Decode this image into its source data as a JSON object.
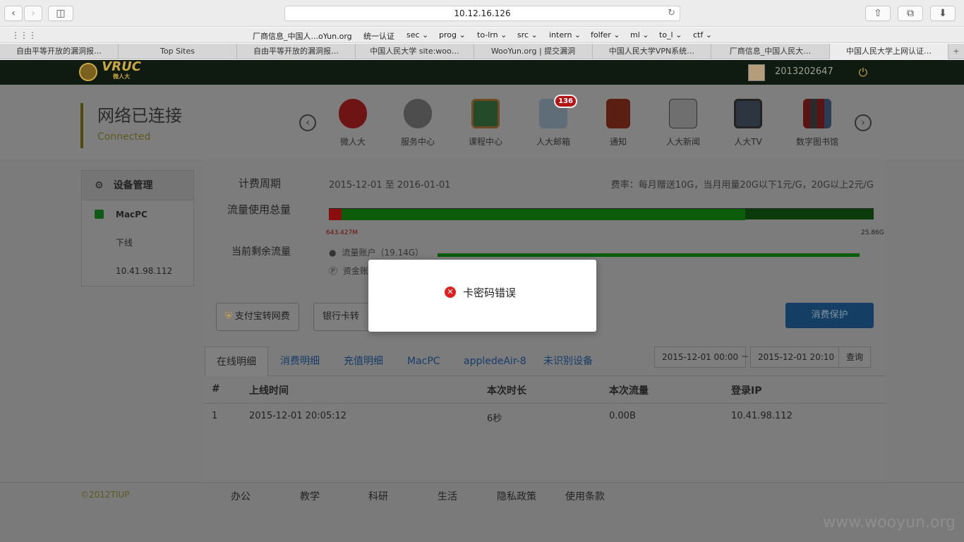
{
  "browser": {
    "url": "10.12.16.126",
    "bookmarks": [
      "厂商信息_中国人...oYun.org",
      "统一认证",
      "sec",
      "prog",
      "to-lrn",
      "src",
      "intern",
      "folfer",
      "ml",
      "to_l",
      "ctf"
    ],
    "tabs": [
      "自由平等开放的漏洞报…",
      "Top Sites",
      "自由平等开放的漏洞报…",
      "中国人民大学 site:woo…",
      "WooYun.org | 提交漏洞",
      "中国人民大学VPN系统…",
      "厂商信息_中国人民大…",
      "中国人民大学上网认证…"
    ]
  },
  "site": {
    "logo_text": "VRUC",
    "logo_sub": "微人大",
    "user_id": "2013202647"
  },
  "status": {
    "title": "网络已连接",
    "subtitle": "Connected"
  },
  "services": [
    {
      "label": "微人大",
      "icon": "weirenda-icon"
    },
    {
      "label": "服务中心",
      "icon": "service-center-icon"
    },
    {
      "label": "课程中心",
      "icon": "course-center-icon"
    },
    {
      "label": "人大邮箱",
      "icon": "mail-icon",
      "badge": "136"
    },
    {
      "label": "通知",
      "icon": "megaphone-icon"
    },
    {
      "label": "人大新闻",
      "icon": "news-icon"
    },
    {
      "label": "人大TV",
      "icon": "tv-icon"
    },
    {
      "label": "数字图书馆",
      "icon": "library-icon"
    }
  ],
  "sidebar": {
    "header": "设备管理",
    "device": "MacPC",
    "action": "下线",
    "ip": "10.41.98.112"
  },
  "billing": {
    "period_label": "计费周期",
    "period_value": "2015-12-01 至 2016-01-01",
    "rate": "费率：每月赠送10G，当月用量20G以下1元/G，20G以上2元/G",
    "usage_label": "流量使用总量",
    "used": "643.427M",
    "total": "25.86G",
    "remaining_label": "当前剩余流量",
    "flow_account": "流量账户（19.14G）",
    "fund_account": "资金账",
    "flow_fraction": 0.98
  },
  "buttons": {
    "alipay": "支付宝转网费",
    "bank": "银行卡转",
    "protect": "消费保护",
    "query": "查询"
  },
  "detail_tabs": [
    "在线明细",
    "消费明细",
    "充值明细",
    "MacPC",
    "appledeAir-8",
    "未识别设备"
  ],
  "date_range": {
    "start": "2015-12-01 00:00",
    "sep": "~",
    "end": "2015-12-01 20:10"
  },
  "table": {
    "headers": [
      "#",
      "上线时间",
      "本次时长",
      "本次流量",
      "登录IP"
    ],
    "rows": [
      [
        "1",
        "2015-12-01 20:05:12",
        "6秒",
        "0.00B",
        "10.41.98.112"
      ]
    ]
  },
  "footer": {
    "copyright": "©2012TIUP",
    "links": [
      "办公",
      "教学",
      "科研",
      "生活",
      "隐私政策",
      "使用条款"
    ],
    "watermark": "www.wooyun.org"
  },
  "modal": {
    "message": "卡密码错误"
  }
}
